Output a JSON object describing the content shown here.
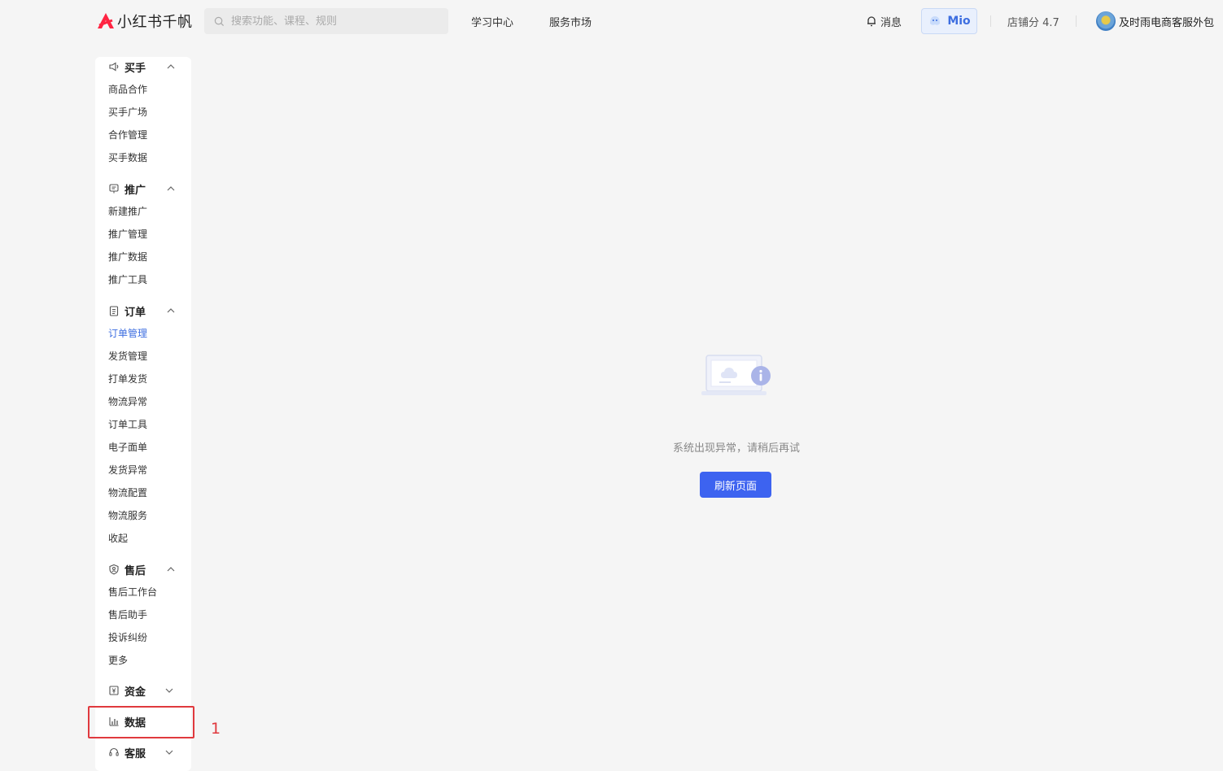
{
  "header": {
    "logo_text": "小红书千帆",
    "search_placeholder": "搜索功能、课程、规则",
    "nav": [
      "学习中心",
      "服务市场"
    ],
    "messages_label": "消息",
    "assistant_label": "Mio",
    "shop_score": "店铺分 4.7",
    "store_name": "及时雨电商客服外包"
  },
  "sidebar": {
    "groups": [
      {
        "label": "买手",
        "icon": "speaker-icon",
        "expanded": true,
        "items": [
          "商品合作",
          "买手广场",
          "合作管理",
          "买手数据"
        ]
      },
      {
        "label": "推广",
        "icon": "promo-icon",
        "expanded": true,
        "items": [
          "新建推广",
          "推广管理",
          "推广数据",
          "推广工具"
        ]
      },
      {
        "label": "订单",
        "icon": "clipboard-icon",
        "expanded": true,
        "items": [
          "订单管理",
          "发货管理",
          "打单发货",
          "物流异常",
          "订单工具",
          "电子面单",
          "发货异常",
          "物流配置",
          "物流服务",
          "收起"
        ],
        "active_item": "订单管理"
      },
      {
        "label": "售后",
        "icon": "shield-icon",
        "expanded": true,
        "items": [
          "售后工作台",
          "售后助手",
          "投诉纠纷",
          "更多"
        ]
      },
      {
        "label": "资金",
        "icon": "yen-icon",
        "expanded": false,
        "items": []
      },
      {
        "label": "数据",
        "icon": "bar-chart-icon",
        "expanded": false,
        "items": []
      },
      {
        "label": "客服",
        "icon": "headset-icon",
        "expanded": false,
        "items": []
      }
    ]
  },
  "annotation": {
    "number": "1",
    "color": "#e0393e"
  },
  "main": {
    "error_message": "系统出现异常，请稍后再试",
    "refresh_button": "刷新页面"
  },
  "colors": {
    "accent": "#3d63f0",
    "active_link": "#3d6ee0",
    "logo_red": "#ff2442"
  }
}
